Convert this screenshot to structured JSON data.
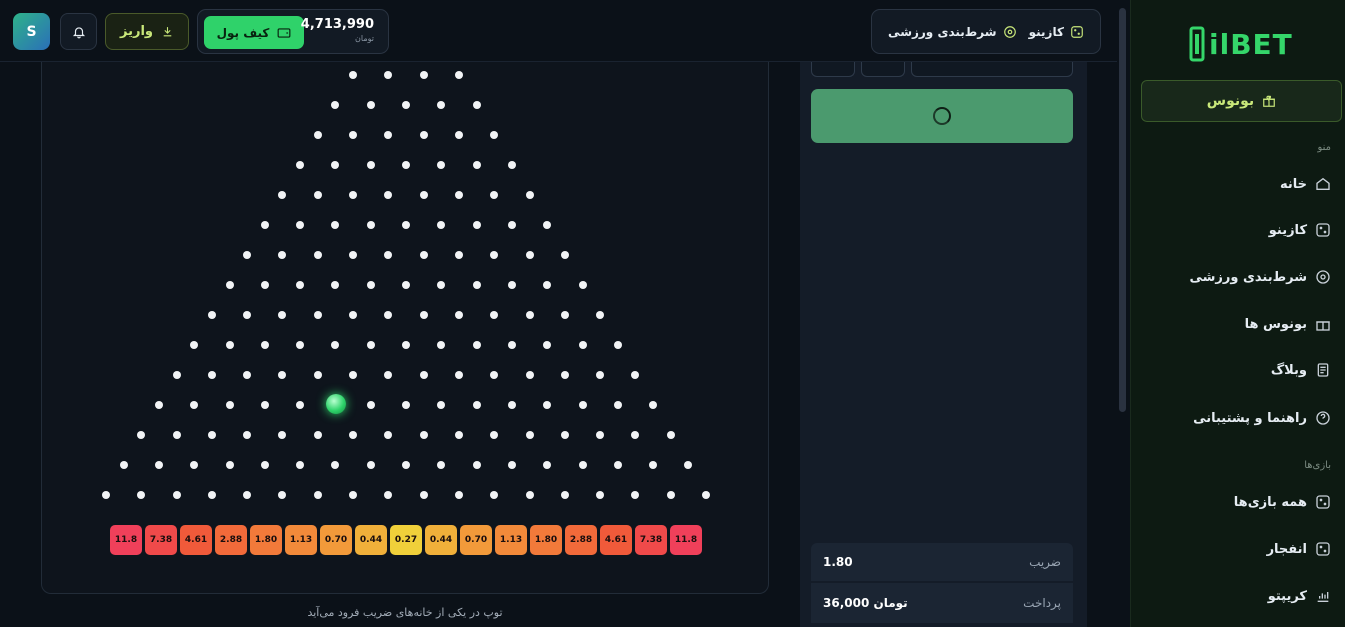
{
  "header": {
    "avatar_letter": "S",
    "deposit_label": "واریز",
    "wallet_label": "کیف پول",
    "balance": "4,713,990",
    "currency": "تومان",
    "tab_casino": "کازینو",
    "tab_sports": "شرط‌بندی ورزشی"
  },
  "sidebar": {
    "logo": "ilBET",
    "bonus_label": "بونوس",
    "menu_section": "منو",
    "games_section": "بازی‌ها",
    "items": [
      {
        "label": "خانه",
        "icon": "home-icon"
      },
      {
        "label": "کازینو",
        "icon": "dice-icon"
      },
      {
        "label": "شرط‌بندی ورزشی",
        "icon": "target-icon"
      },
      {
        "label": "بونوس ها",
        "icon": "gift-icon"
      },
      {
        "label": "وبلاگ",
        "icon": "document-icon"
      },
      {
        "label": "راهنما و پشتیبانی",
        "icon": "help-icon"
      }
    ],
    "games": [
      {
        "label": "همه بازی‌ها",
        "icon": "dice-icon"
      },
      {
        "label": "انفجار",
        "icon": "dice-icon"
      },
      {
        "label": "کریپتو",
        "icon": "chart-icon"
      }
    ]
  },
  "game": {
    "multipliers": [
      "11.8",
      "7.38",
      "4.61",
      "2.88",
      "1.80",
      "1.13",
      "0.70",
      "0.44",
      "0.27",
      "0.44",
      "0.70",
      "1.13",
      "1.80",
      "2.88",
      "4.61",
      "7.38",
      "11.8"
    ],
    "slot_colors": [
      "#f0405a",
      "#f04a4a",
      "#f05a3a",
      "#f26a3a",
      "#f27a3a",
      "#f28a3a",
      "#f29a3a",
      "#f0b03a",
      "#f0d03a",
      "#f0b03a",
      "#f29a3a",
      "#f28a3a",
      "#f27a3a",
      "#f26a3a",
      "#f05a3a",
      "#f04a4a",
      "#f0405a"
    ],
    "hint": "توپ در یکی از خانه‌های ضریب فرود می‌آید"
  },
  "panel": {
    "multiplier_label": "ضریب",
    "multiplier_value": "1.80",
    "payout_label": "پرداخت",
    "payout_value": "36,000 تومان"
  }
}
